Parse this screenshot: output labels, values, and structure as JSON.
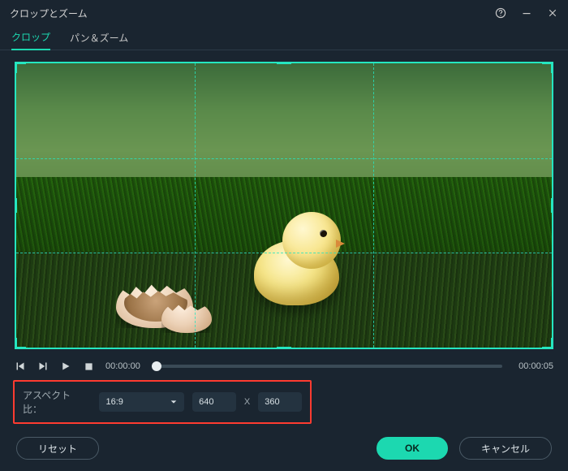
{
  "titlebar": {
    "title": "クロップとズーム"
  },
  "tabs": {
    "crop": "クロップ",
    "panzoom": "パン＆ズーム"
  },
  "playbar": {
    "current": "00:00:00",
    "duration": "00:00:05"
  },
  "aspect": {
    "label": "アスペクト比：",
    "ratio": "16:9",
    "width": "640",
    "x": "X",
    "height": "360"
  },
  "buttons": {
    "reset": "リセット",
    "ok": "OK",
    "cancel": "キャンセル"
  }
}
